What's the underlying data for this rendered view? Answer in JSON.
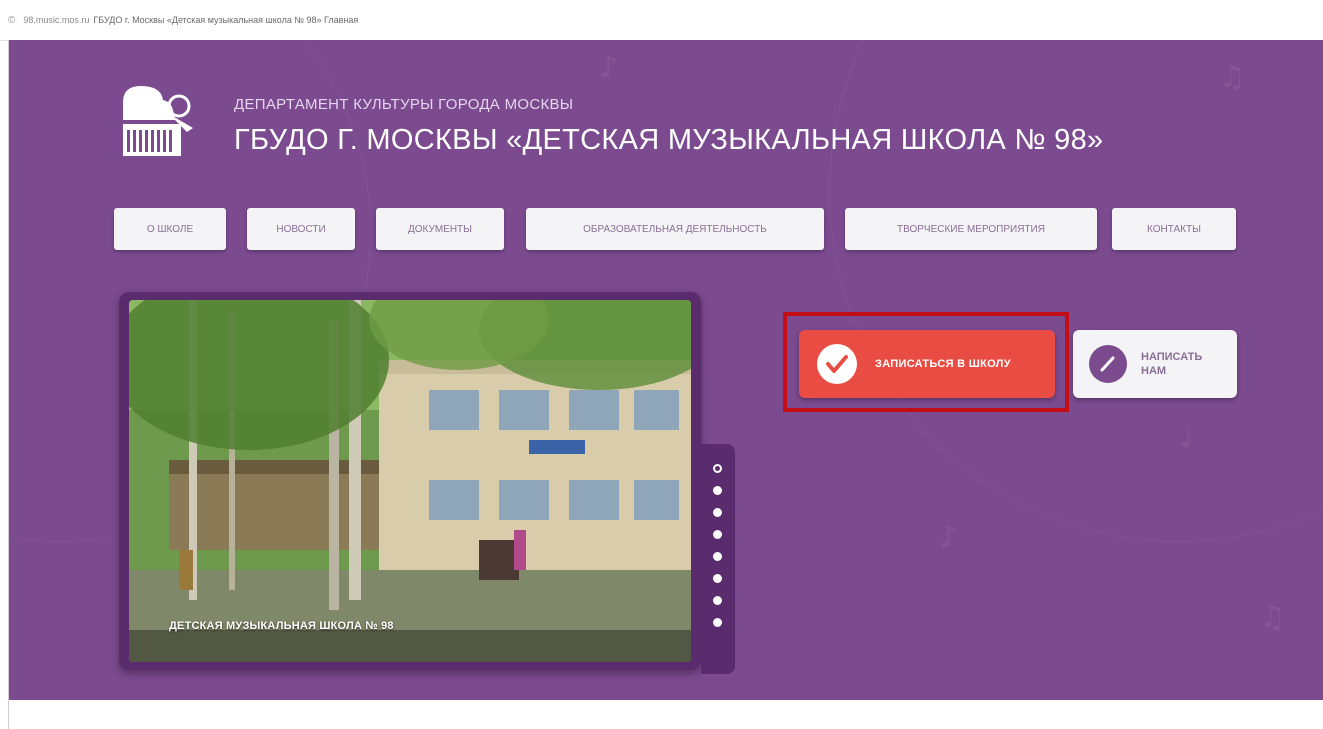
{
  "browser": {
    "url": "98.music.mos.ru",
    "title": "ГБУДО г. Москвы «Детская музыкальная школа № 98» Главная"
  },
  "header": {
    "department": "ДЕПАРТАМЕНТ КУЛЬТУРЫ ГОРОДА МОСКВЫ",
    "school_name": "ГБУДО Г. МОСКВЫ «ДЕТСКАЯ МУЗЫКАЛЬНАЯ ШКОЛА № 98»"
  },
  "nav": {
    "items": [
      {
        "label": "О ШКОЛЕ"
      },
      {
        "label": "НОВОСТИ"
      },
      {
        "label": "ДОКУМЕНТЫ"
      },
      {
        "label": "ОБРАЗОВАТЕЛЬНАЯ ДЕЯТЕЛЬНОСТЬ"
      },
      {
        "label": "ТВОРЧЕСКИЕ МЕРОПРИЯТИЯ"
      },
      {
        "label": "КОНТАКТЫ"
      }
    ]
  },
  "slider": {
    "caption": "ДЕТСКАЯ МУЗЫКАЛЬНАЯ ШКОЛА № 98",
    "total_slides": 8,
    "active_slide": 1
  },
  "actions": {
    "enroll_label": "ЗАПИСАТЬСЯ В ШКОЛУ",
    "write_label": "НАПИСАТЬ НАМ"
  },
  "colors": {
    "page_background": "#7b4a8f",
    "enroll_button": "#e94c43",
    "highlight": "#c40d15"
  }
}
